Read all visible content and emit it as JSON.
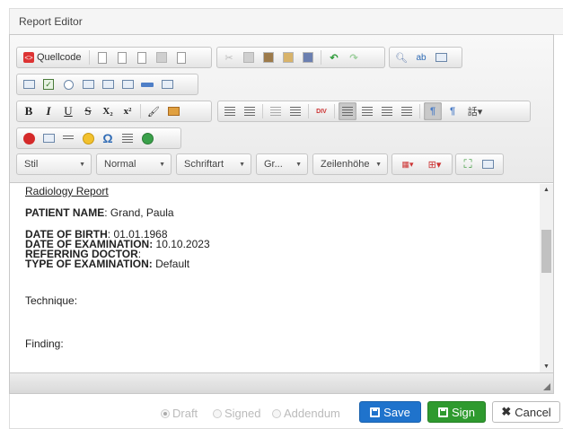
{
  "panel": {
    "title": "Report Editor"
  },
  "toolbar": {
    "source_label": "Quellcode",
    "bold": "B",
    "italic": "I",
    "underline": "U",
    "strike": "S",
    "subscript": "X₂",
    "superscript": "x²",
    "div_label": "DIV",
    "omega": "Ω",
    "style_combo": "Stil",
    "format_combo": "Normal",
    "font_combo": "Schriftart",
    "size_combo": "Gr...",
    "lineheight_combo": "Zeilenhöhe"
  },
  "report": {
    "heading": "Radiology Report",
    "patient_name_label": "PATIENT NAME",
    "patient_name_value": ": Grand, Paula",
    "dob_label": "DATE OF BIRTH",
    "dob_value": ": 01.01.1968",
    "doe_label": "DATE OF EXAMINATION:",
    "doe_value": " 10.10.2023",
    "referring_label": "REFERRING DOCTOR",
    "referring_value": ":",
    "type_label": "TYPE OF EXAMINATION:",
    "type_value": " Default",
    "technique_label": "Technique:",
    "finding_label": "Finding:"
  },
  "status_options": [
    {
      "label": "Draft",
      "selected": true
    },
    {
      "label": "Signed",
      "selected": false
    },
    {
      "label": "Addendum",
      "selected": false
    }
  ],
  "actions": {
    "save_label": "Save",
    "sign_label": "Sign",
    "cancel_label": "Cancel"
  },
  "colors": {
    "save": "#1f73cc",
    "sign": "#2f9a2f"
  }
}
